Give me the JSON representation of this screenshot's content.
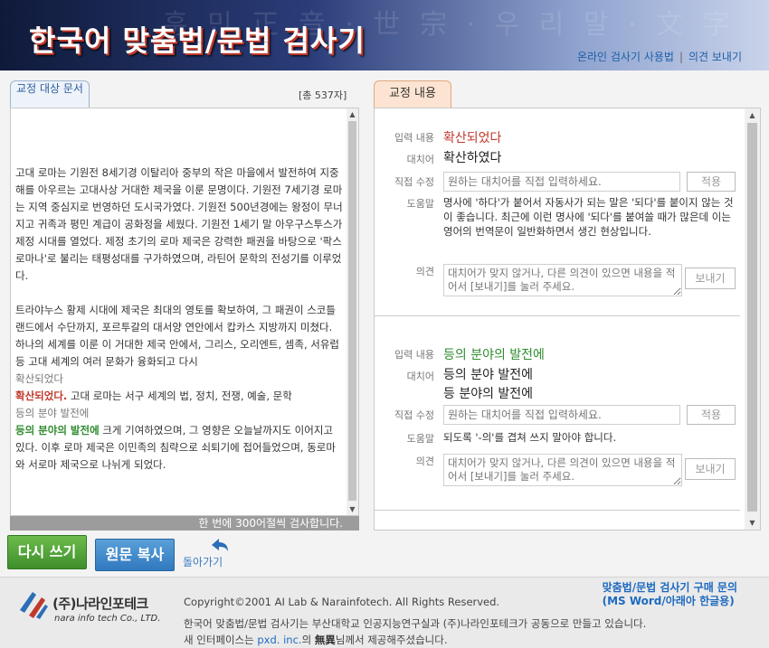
{
  "header": {
    "title": "한국어 맞춤법/문법 검사기",
    "background_text": "훈 민 正 音 · 世 宗 · 우 리 말 · 文 字",
    "links": [
      "온라인 검사기 사용법",
      "의견 보내기"
    ],
    "link_separator": "|"
  },
  "left_panel": {
    "tab_label": "교정 대상 문서",
    "char_count": "[총 537자]",
    "paragraphs": [
      "고대 로마는 기원전 8세기경 이탈리아 중부의 작은 마을에서 발전하여 지중해를 아우르는 고대사상 거대한 제국을 이룬 문명이다. 기원전 7세기경 로마는 지역 중심지로 번영하던 도시국가였다. 기원전 500년경에는 왕정이 무너지고 귀족과 평민 계급이 공화정을 세웠다. 기원전 1세기 말 아우구스투스가 제정 시대를 열었다. 제정 초기의 로마 제국은 강력한 패권을 바탕으로 '팍스 로마나'로 불리는 태평성대를 구가하였으며, 라틴어 문학의 전성기를 이루었다."
    ],
    "para2_before": "트라야누스 황제 시대에 제국은 최대의 영토를 확보하여, 그 패권이 스코틀랜드에서 수단까지, 포르투갈의 대서양 연안에서 캅카스 지방까지 미쳤다. 하나의 세계를 이룬 이 거대한 제국 안에서, 그리스, 오리엔트, 셈족, 서유럽 등 고대 세계의 여러 문화가 융화되고 다시",
    "para2_tip1": "확산되었다",
    "para2_err1": "확산되었다.",
    "para2_mid": " 고대 로마는 서구 세계의 법, 정치, 전쟁, 예술, 문학",
    "para2_tip2": "등의 분야 발전에",
    "para2_err2": "등의 분야의 발전에",
    "para2_after": " 크게 기여하였으며, 그 영향은 오늘날까지도 이어지고 있다. 이후 로마 제국은 이민족의 침략으로 쇠퇴기에 접어들었으며, 동로마와 서로마 제국으로 나뉘게 되었다.",
    "footer_note": "한 번에 300어절씩 검사합니다."
  },
  "actions": {
    "rewrite": "다시 쓰기",
    "copy": "원문 복사",
    "back": "돌아가기"
  },
  "right_panel": {
    "tab_label": "교정 내용",
    "labels": {
      "input": "입력 내용",
      "replacement": "대치어",
      "direct": "직접 수정",
      "help": "도움말",
      "opinion": "의견"
    },
    "direct_placeholder": "원하는 대치어를 직접 입력하세요.",
    "apply_label": "적용",
    "opinion_placeholder": "대치어가 맞지 않거나, 다른 의견이 있으면 내용을 적어서 [보내기]를 눌러 주세요.",
    "send_label": "보내기",
    "items": [
      {
        "input": "확산되었다",
        "replacements": [
          "확산하였다"
        ],
        "help": "명사에 '하다'가 붙어서 자동사가 되는 말은 '되다'를 붙이지 않는 것이 좋습니다. 최근에 이런 명사에 '되다'를 붙여쓸 때가 많은데 이는 영어의 번역문이 일반화하면서 생긴 현상입니다."
      },
      {
        "input": "등의 분야의 발전에",
        "replacements": [
          "등의 분야 발전에",
          "등 분야의 발전에"
        ],
        "help": "되도록 '-의'를 겹쳐 쓰지 말아야 합니다."
      }
    ]
  },
  "footer": {
    "logo_ko": "(주)나라인포테크",
    "logo_en": "nara info tech Co., LTD.",
    "copyright": "Copyright©2001 AI Lab & Narainfotech. All Rights Reserved.",
    "buy_line1": "맞춤법/문법 검사기 구매 문의",
    "buy_line2": "(MS Word/아래아 한글용)",
    "desc1": "한국어 맞춤법/문법 검사기는 부산대학교 인공지능연구실과 (주)나라인포테크가 공동으로 만들고 있습니다.",
    "desc2_before": "새 인터페이스는 ",
    "desc2_link": "pxd. inc.",
    "desc2_mid": "의 ",
    "desc2_bold": "無異",
    "desc2_after": "님께서 제공해주셨습니다."
  },
  "colors": {
    "error": "#c0392b",
    "suggestion": "#2e8b2e",
    "link": "#1d6ac0",
    "rewrite_button": "#4ea33a",
    "copy_button": "#3b86c8"
  }
}
